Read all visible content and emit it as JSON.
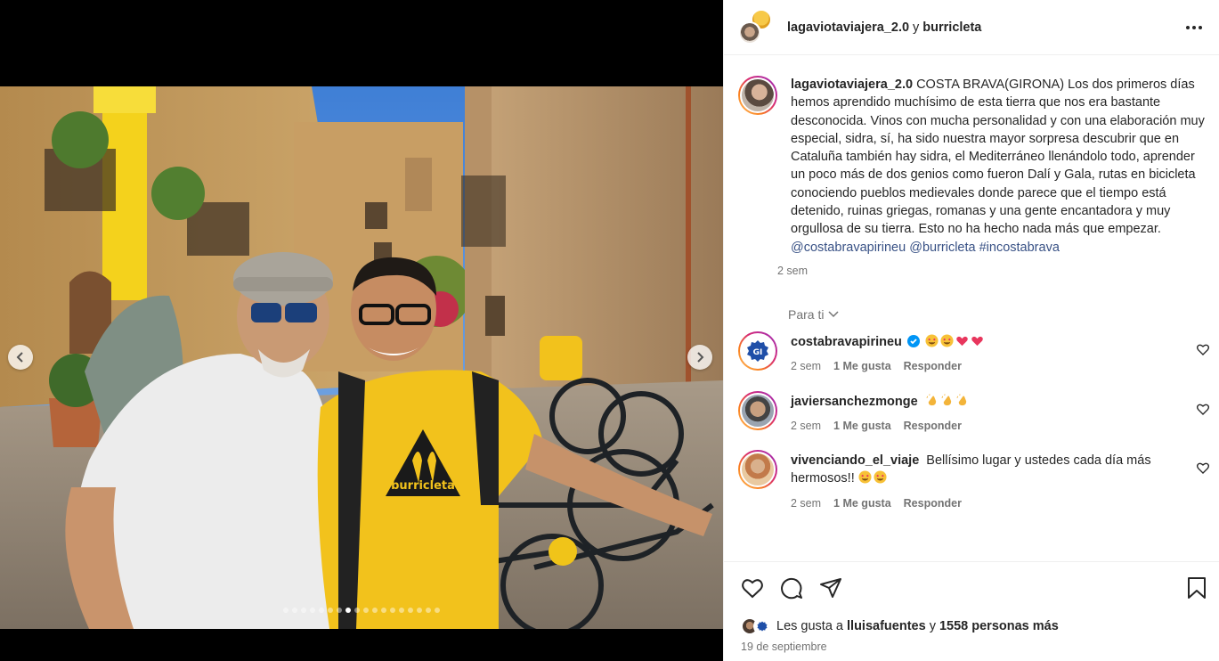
{
  "post": {
    "author": "lagaviotaviajera_2.0",
    "conjunction": "y",
    "coauthor": "burricleta",
    "caption_text": " COSTA BRAVA(GIRONA) Los dos primeros días hemos aprendido muchísimo de esta tierra que nos era bastante desconocida. Vinos con mucha personalidad y con una elaboración muy especial, sidra, sí, ha sido nuestra mayor sorpresa descubrir que en Cataluña también hay sidra, el Mediterráneo llenándolo todo, aprender un poco más de dos genios como fueron Dalí y Gala, rutas en bicicleta conociendo pueblos medievales donde parece que el tiempo está detenido, ruinas griegas, romanas y una gente encantadora y muy orgullosa de su tierra. Esto no ha hecho nada más que empezar.",
    "mention_1": "@costabravapirineu",
    "mention_2": "@burricleta",
    "hashtag": "#incostabrava",
    "caption_time": "2 sem",
    "photo_shirt_text": "burricleta",
    "carousel_total": 18,
    "carousel_active": 7
  },
  "para_ti": "Para ti",
  "comments": [
    {
      "user": "costabravapirineu",
      "time": "2 sem",
      "likes": "1 Me gusta",
      "reply": "Responder"
    },
    {
      "user": "javiersanchezmonge",
      "time": "2 sem",
      "likes": "1 Me gusta",
      "reply": "Responder"
    },
    {
      "user": "vivenciando_el_viaje",
      "text": "Bellísimo lugar y ustedes cada día más hermosos!!",
      "time": "2 sem",
      "likes": "1 Me gusta",
      "reply": "Responder"
    }
  ],
  "likes_bar": {
    "prefix": "Les gusta a",
    "user": "lluisafuentes",
    "and": "y",
    "others": "1558 personas más"
  },
  "date": "19 de septiembre",
  "colors": {
    "link": "#385185",
    "verified": "#0095f6",
    "shirt": "#f2c21c"
  }
}
